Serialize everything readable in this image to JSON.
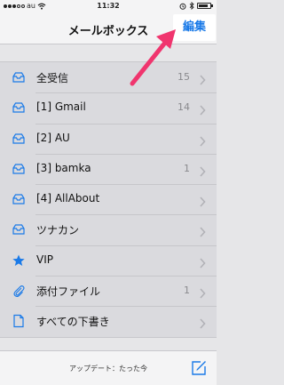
{
  "status_bar": {
    "carrier": "au",
    "time": "11:32",
    "battery_level": 0.85
  },
  "nav": {
    "title": "メールボックス",
    "edit_label": "編集"
  },
  "mailboxes": [
    {
      "label": "全受信",
      "count": "15",
      "icon": "inbox-tray-icon"
    },
    {
      "label": "[1] Gmail",
      "count": "14",
      "icon": "inbox-tray-icon"
    },
    {
      "label": "[2] AU",
      "count": "",
      "icon": "inbox-tray-icon"
    },
    {
      "label": "[3] bamka",
      "count": "1",
      "icon": "inbox-tray-icon"
    },
    {
      "label": "[4] AllAbout",
      "count": "",
      "icon": "inbox-tray-icon"
    },
    {
      "label": "ツナカン",
      "count": "",
      "icon": "inbox-tray-icon"
    },
    {
      "label": "VIP",
      "count": "",
      "icon": "star-icon"
    },
    {
      "label": "添付ファイル",
      "count": "1",
      "icon": "paperclip-icon"
    },
    {
      "label": "すべての下書き",
      "count": "",
      "icon": "document-icon"
    }
  ],
  "toolbar": {
    "update_text": "アップデート：たった今"
  },
  "colors": {
    "accent": "#1a7ae8",
    "annotation_arrow": "#f0356e"
  }
}
